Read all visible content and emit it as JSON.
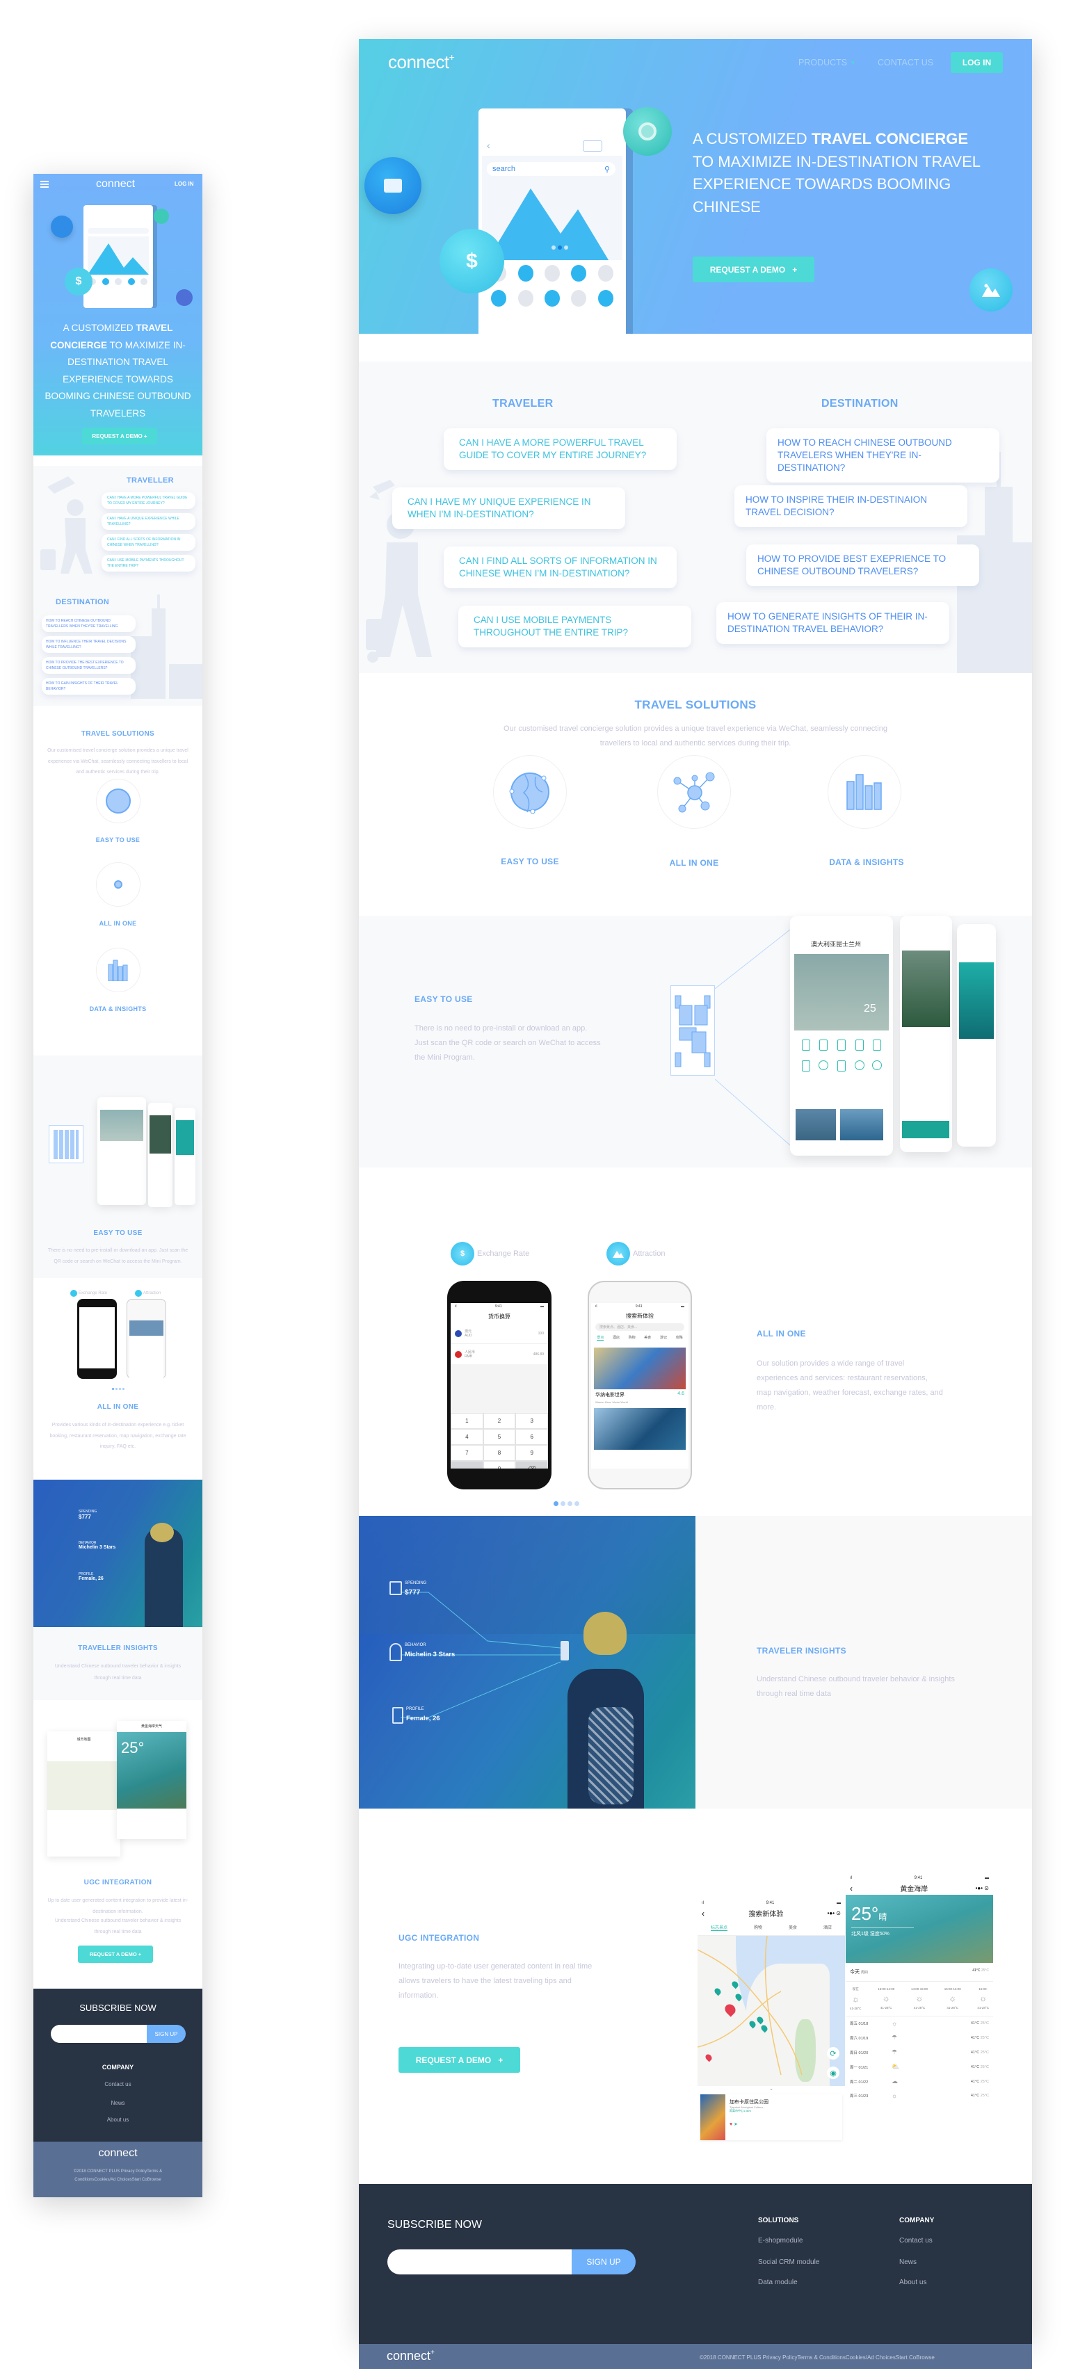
{
  "desktop": {
    "nav": {
      "logo": "connect",
      "products": "PRODUCTS",
      "contact": "CONTACT US",
      "login": "LOG IN"
    },
    "hero": {
      "headline_pre": "A CUSTOMIZED ",
      "headline_bold1": "TRAVEL CONCIERGE",
      "headline_post": " TO MAXIMIZE IN-DESTINATION TRAVEL EXPERIENCE TOWARDS BOOMING CHINESE",
      "cta": "REQUEST A DEMO",
      "search_placeholder": "search"
    },
    "questions": {
      "traveler_title": "TRAVELER",
      "destination_title": "DESTINATION",
      "traveler": [
        "CAN I HAVE A MORE POWERFUL TRAVEL GUIDE TO COVER MY ENTIRE JOURNEY?",
        "CAN I HAVE MY UNIQUE EXPERIENCE IN WHEN I'M IN-DESTINATION?",
        "CAN I FIND ALL SORTS OF INFORMATION IN CHINESE WHEN I'M IN-DESTINATION?",
        "CAN I USE MOBILE PAYMENTS THROUGHOUT THE ENTIRE TRIP?"
      ],
      "destination": [
        "HOW TO REACH CHINESE OUTBOUND TRAVELERS WHEN THEY'RE IN-DESTINATION?",
        "HOW TO INSPIRE THEIR IN-DESTINAION TRAVEL DECISION?",
        "HOW TO PROVIDE BEST EXEPRIENCE TO CHINESE OUTBOUND TRAVELERS?",
        "HOW TO GENERATE INSIGHTS OF THEIR IN-DESTINATION TRAVEL BEHAVIOR?"
      ]
    },
    "solutions": {
      "title": "TRAVEL SOLUTIONS",
      "desc": "Our customised travel concierge solution provides a unique travel experience via WeChat, seamlessly connecting travellers to local and authentic services during their trip.",
      "items": [
        {
          "label": "EASY TO USE",
          "icon": "globe-icon"
        },
        {
          "label": "ALL IN ONE",
          "icon": "network-icon"
        },
        {
          "label": "DATA & INSIGHTS",
          "icon": "bar-chart-icon"
        }
      ]
    },
    "easy": {
      "title": "EASY TO USE",
      "desc": "There is no need to pre-install or download an app. Just scan the QR code or search on WeChat to access the Mini Program.",
      "phone_title": "澳大利亚昆士兰州",
      "temp": "25"
    },
    "allinone": {
      "tab1": "Exchange Rate",
      "tab2": "Attraction",
      "title": "ALL IN ONE",
      "desc": "Our solution provides a wide range of travel experiences and services: restaurant reservations, map navigation, weather forecast, exchange rates, and more.",
      "phone1": {
        "time": "9:41",
        "title": "货币换算",
        "cur1_name": "澳元",
        "cur1_code": "AUD",
        "cur1_val": "100",
        "cur2_name": "人民币",
        "cur2_code": "RMB",
        "cur2_val": "486.89",
        "keys": [
          "1",
          "2",
          "3",
          "4",
          "5",
          "6",
          "7",
          "8",
          "9",
          ".",
          "0",
          "⌫"
        ]
      },
      "phone2": {
        "time": "9:41",
        "title": "搜索新体验",
        "search": "搜索景点、酒店、美食...",
        "tabs": [
          "景点",
          "酒店",
          "购物",
          "美食",
          "游记",
          "攻略"
        ],
        "card_title": "华纳电影世界",
        "card_sub": "Warner Bros. Movie World",
        "card_rating": "4.6"
      },
      "dots": 4,
      "active_dot": 0
    },
    "insights": {
      "title": "TRAVELER INSIGHTS",
      "desc": "Understand Chinese outbound traveler behavior & insights through real time data",
      "spending_label": "SPENDING",
      "spending_value": "$777",
      "behavior_label": "BEHAVIOR",
      "behavior_value": "Michelin 3 Stars",
      "profile_label": "PROFILE",
      "profile_value": "Female, 26"
    },
    "ugc": {
      "title": "UGC INTEGRATION",
      "desc": "Integrating up-to-date user generated content in real time allows travelers to have the latest traveling tips and information.",
      "cta": "REQUEST A DEMO",
      "map_phone": {
        "time": "9:41",
        "title": "搜索新体验",
        "tabs": [
          "标志景点",
          "购物",
          "美食",
          "酒店"
        ],
        "card_title": "加布卡原住民公园",
        "card_sub": "Tjapukai Aboriginal Cultura...",
        "card_dist": "距离市中心1.5km"
      },
      "weather_phone": {
        "time": "9:41",
        "title": "黄金海岸",
        "temp": "25°",
        "cond": "晴",
        "wind": "北风1级 湿度50%",
        "today": "今天",
        "today_day": "周四",
        "today_hi": "41°C",
        "today_lo": "25°C",
        "hours": [
          "现在",
          "13:00-14:00",
          "14:00-15:00",
          "15:00-16:00",
          "16:00-"
        ],
        "hour_temp": "41-28°C",
        "days": [
          {
            "day": "周五",
            "date": "01/18",
            "hi": "41°C",
            "lo": "25°C"
          },
          {
            "day": "周六",
            "date": "01/19",
            "hi": "41°C",
            "lo": "25°C"
          },
          {
            "day": "周日",
            "date": "01/20",
            "hi": "41°C",
            "lo": "25°C"
          },
          {
            "day": "周一",
            "date": "01/21",
            "hi": "41°C",
            "lo": "25°C"
          },
          {
            "day": "周二",
            "date": "01/22",
            "hi": "41°C",
            "lo": "25°C"
          },
          {
            "day": "周三",
            "date": "01/23",
            "hi": "41°C",
            "lo": "25°C"
          }
        ]
      }
    },
    "footer": {
      "subscribe": "SUBSCRIBE NOW",
      "signup": "SIGN UP",
      "email_placeholder": "",
      "solutions_title": "SOLUTIONS",
      "solutions": [
        "E-shopmodule",
        "Social CRM module",
        "Data module"
      ],
      "company_title": "COMPANY",
      "company": [
        "Contact us",
        "News",
        "About us"
      ],
      "logo": "connect",
      "copyright": "©2018 CONNECT PLUS Privacy PolicyTerms & ConditionsCookies/Ad ChoicesStart CoBrowse"
    }
  },
  "mobile": {
    "nav": {
      "logo": "connect",
      "login": "LOG IN"
    },
    "hero": {
      "headline_pre": "A CUSTOMIZED ",
      "headline_bold": "TRAVEL CONCIERGE",
      "headline_post": " TO MAXIMIZE IN-DESTINATION TRAVEL EXPERIENCE TOWARDS BOOMING CHINESE OUTBOUND TRAVELERS",
      "cta": "REQUEST A DEMO +"
    },
    "traveller_title": "TRAVELLER",
    "traveller": [
      "CAN I HAVE A MORE POWERFUL TRAVEL GUIDE TO COVER MY ENTIRE JOURNEY?",
      "CAN I HAVE A UNIQUE EXPERIENCE WHILE TRAVELLING?",
      "CAN I FIND ALL SORTS OF INFORMATION IN CHINESE WHEN TRAVELLING?",
      "CAN I USE MOBILE PAYMENTS THROUGHOUT THE ENTIRE TRIP?"
    ],
    "destination_title": "DESTINATION",
    "destination": [
      "HOW TO REACH CHINESE OUTBOUND TRAVELLERS WHEN THEY'RE TRAVELLING",
      "HOW TO INFLUENCE THEIR TRAVEL DECISIONS WHILE TRAVELLING?",
      "HOW TO PROVIDE THE BEST EXPERIENCE TO CHINESE OUTBOUND TRAVELLERS?",
      "HOW TO GAIN INSIGHTS OF THEIR TRAVEL BEHAVIOR?"
    ],
    "solutions_title": "TRAVEL SOLUTIONS",
    "solutions_desc": "Our customised travel concierge solution provides a unique travel experience via WeChat, seamlessly connecting travellers to local and authentic services during their trip.",
    "solutions_items": [
      "EASY TO USE",
      "ALL IN ONE",
      "DATA & INSIGHTS"
    ],
    "easy_title": "EASY TO USE",
    "easy_desc": "There is no need to pre-install or download an app. Just scan the QR code or search on WeChat to access the Mini Program.",
    "tab1": "Exchange Rate",
    "tab2": "Attraction",
    "allinone_title": "ALL IN ONE",
    "allinone_desc": "Provides various kinds of in-destination experience e.g.  ticket booking, restaurant reservation, map navigation, exchange rate inquiry, FAQ etc.",
    "insights": {
      "spending_label": "SPENDING",
      "spending_value": "$777",
      "behavior_label": "BEHAVIOR",
      "behavior_value": "Michelin 3 Stars",
      "profile_label": "PROFILE",
      "profile_value": "Female, 26"
    },
    "insights_title": "TRAVELLER INSIGHTS",
    "insights_desc": "Understand Chinese outbound traveler behavior & insights through real time data",
    "ugc_map_title": "城市地图",
    "ugc_weather_title": "黄金海岸天气",
    "ugc_temp": "25°",
    "ugc_title": "UGC INTEGRATION",
    "ugc_desc1": "Up to date user generated content integration to provide latest in-destination information.",
    "ugc_desc2": "Understand Chinese outbound traveler behavior & insights through real time data",
    "ugc_cta": "REQUEST A DEMO +",
    "footer": {
      "subscribe": "SUBSCRIBE NOW",
      "signup": "SIGN UP",
      "company_title": "COMPANY",
      "company": [
        "Contact us",
        "News",
        "About us"
      ],
      "logo": "connect",
      "copyright": "©2018 CONNECT PLUS Privacy PolicyTerms & ConditionsCookies/Ad ChoicesStart CoBrowse"
    }
  },
  "colors": {
    "accent_blue": "#6aaaf6",
    "teal": "#4dd9d5",
    "hero_start": "#56cfe4",
    "hero_end": "#74b2fb",
    "footer_dark": "#283344",
    "footer_bar": "#5a6f94",
    "question_text": "#3dc3e0"
  }
}
